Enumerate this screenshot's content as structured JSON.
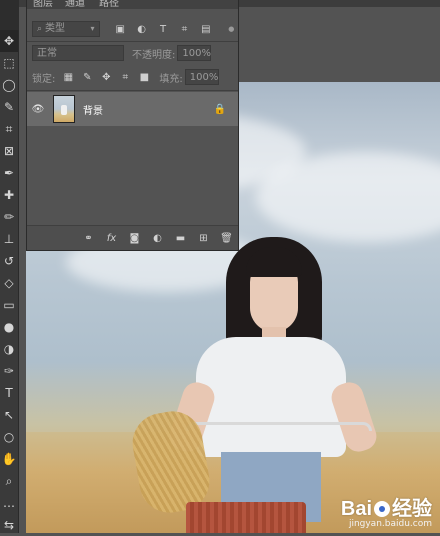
{
  "panel": {
    "tabs": [
      "图层",
      "通道",
      "路径"
    ],
    "filter": {
      "icon": "search-icon",
      "placeholder": "类型"
    },
    "blend_mode": "正常",
    "opacity_label": "不透明度:",
    "opacity_value": "100%",
    "lock_label": "锁定:",
    "fill_label": "填充:",
    "fill_value": "100%",
    "layers": [
      {
        "name": "背景",
        "visible": true,
        "locked": true
      }
    ]
  },
  "watermark": {
    "brand": "Bai",
    "brand_suffix": "经验",
    "url": "jingyan.baidu.com"
  },
  "toolbar": {
    "tools": [
      "move-tool-icon",
      "marquee-tool-icon",
      "lasso-tool-icon",
      "quick-select-tool-icon",
      "crop-tool-icon",
      "frame-tool-icon",
      "eyedropper-tool-icon",
      "healing-brush-icon",
      "brush-tool-icon",
      "clone-stamp-icon",
      "history-brush-icon",
      "eraser-icon",
      "gradient-tool-icon",
      "blur-tool-icon",
      "dodge-tool-icon",
      "pen-tool-icon",
      "type-tool-icon",
      "path-select-icon",
      "rectangle-tool-icon",
      "hand-tool-icon",
      "zoom-tool-icon",
      "more-tools-icon",
      "swap-colors-icon"
    ],
    "glyphs": [
      "✥",
      "⬚",
      "◯",
      "✎",
      "⌗",
      "⊠",
      "✒",
      "✚",
      "✏",
      "⊥",
      "↺",
      "◇",
      "▭",
      "●",
      "◑",
      "✑",
      "T",
      "↖",
      "○",
      "✋",
      "⌕",
      "…",
      "⇆"
    ]
  },
  "colors": {
    "panel_bg": "#535353",
    "selected_row": "#6a6a6a",
    "toolbar_bg": "#3a3a3a"
  }
}
